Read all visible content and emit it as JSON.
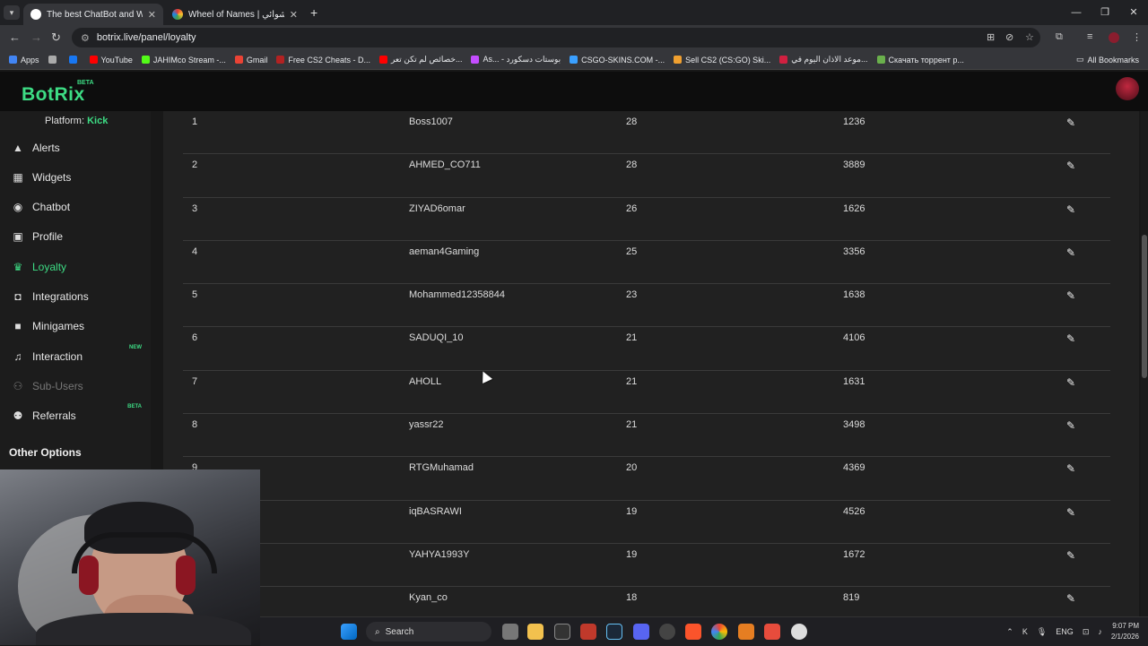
{
  "browser": {
    "tabs": [
      {
        "title": "The best ChatBot and Widgets",
        "active": true,
        "icon": "botrix-favicon"
      },
      {
        "title": "Wheel of Names | اسم العشوائي",
        "active": false,
        "icon": "wheel-favicon"
      }
    ],
    "new_tab": "+",
    "window_controls": [
      "—",
      "❐",
      "✕"
    ],
    "url": "botrix.live/panel/loyalty",
    "bookmarks": [
      {
        "label": "Apps",
        "color": "#4285f4"
      },
      {
        "label": "",
        "color": "#aaaaaa"
      },
      {
        "label": "",
        "color": "#1877f2"
      },
      {
        "label": "YouTube",
        "color": "#ff0000"
      },
      {
        "label": "JAHIMco Stream -...",
        "color": "#53fc18"
      },
      {
        "label": "Gmail",
        "color": "#ea4335"
      },
      {
        "label": "Free CS2 Cheats - D...",
        "color": "#b22222"
      },
      {
        "label": "خصائص لم تكن تعر...",
        "color": "#ff0000"
      },
      {
        "label": "As... - بوستات دسكورد",
        "color": "#c44dff"
      },
      {
        "label": "CSGO-SKINS.COM -...",
        "color": "#3aa0ff"
      },
      {
        "label": "Sell CS2 (CS:GO) Ski...",
        "color": "#f0a030"
      },
      {
        "label": "موعد الاذان اليوم في...",
        "color": "#d02040"
      },
      {
        "label": "Скачать торрент р...",
        "color": "#6ab04c"
      }
    ],
    "all_bookmarks": "All Bookmarks"
  },
  "app": {
    "logo": "BotRix",
    "logo_badge": "BETA",
    "platform_label": "Platform:",
    "platform_value": "Kick"
  },
  "sidebar": {
    "items": [
      {
        "label": "Alerts",
        "icon": "warning-icon",
        "glyph": "▲",
        "state": ""
      },
      {
        "label": "Widgets",
        "icon": "table-icon",
        "glyph": "▦",
        "state": ""
      },
      {
        "label": "Chatbot",
        "icon": "robot-icon",
        "glyph": "◉",
        "state": ""
      },
      {
        "label": "Profile",
        "icon": "id-card-icon",
        "glyph": "▣",
        "state": ""
      },
      {
        "label": "Loyalty",
        "icon": "trophy-icon",
        "glyph": "♛",
        "state": "active"
      },
      {
        "label": "Integrations",
        "icon": "puzzle-icon",
        "glyph": "◘",
        "state": ""
      },
      {
        "label": "Minigames",
        "icon": "gamepad-icon",
        "glyph": "■",
        "state": ""
      },
      {
        "label": "Interaction",
        "icon": "music-icon",
        "glyph": "♫",
        "state": "",
        "badge": "NEW"
      },
      {
        "label": "Sub-Users",
        "icon": "users-icon",
        "glyph": "⚇",
        "state": "dim"
      },
      {
        "label": "Referrals",
        "icon": "referral-users-icon",
        "glyph": "⚉",
        "state": "",
        "badge": "BETA"
      }
    ],
    "other_options": "Other Options"
  },
  "leaderboard": {
    "rows": [
      {
        "rank": "1",
        "name": "Boss1007",
        "level": "28",
        "points": "1236"
      },
      {
        "rank": "2",
        "name": "AHMED_CO711",
        "level": "28",
        "points": "3889"
      },
      {
        "rank": "3",
        "name": "ZIYAD6omar",
        "level": "26",
        "points": "1626"
      },
      {
        "rank": "4",
        "name": "aeman4Gaming",
        "level": "25",
        "points": "3356"
      },
      {
        "rank": "5",
        "name": "Mohammed12358844",
        "level": "23",
        "points": "1638"
      },
      {
        "rank": "6",
        "name": "SADUQI_10",
        "level": "21",
        "points": "4106"
      },
      {
        "rank": "7",
        "name": "AHOLL",
        "level": "21",
        "points": "1631"
      },
      {
        "rank": "8",
        "name": "yassr22",
        "level": "21",
        "points": "3498"
      },
      {
        "rank": "9",
        "name": "RTGMuhamad",
        "level": "20",
        "points": "4369"
      },
      {
        "rank": "",
        "name": "iqBASRAWI",
        "level": "19",
        "points": "4526"
      },
      {
        "rank": "",
        "name": "YAHYA1993Y",
        "level": "19",
        "points": "1672"
      },
      {
        "rank": "",
        "name": "Kyan_co",
        "level": "18",
        "points": "819"
      }
    ],
    "edit_glyph": "✎"
  },
  "taskbar": {
    "search_label": "Search",
    "language": "ENG",
    "time": "9:07 PM",
    "date": "2/1/2026"
  }
}
